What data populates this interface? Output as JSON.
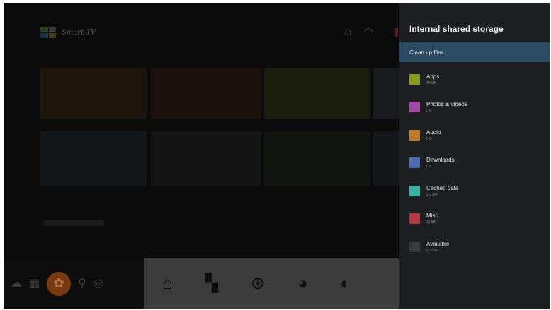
{
  "launcher": {
    "logo_text": "Smart TV"
  },
  "panel": {
    "title": "Internal shared storage",
    "clean_up_label": "Clean up files",
    "items": [
      {
        "label": "Apps",
        "value": "13 MB",
        "color": "#8a9a1c"
      },
      {
        "label": "Photos & videos",
        "value": "0 B",
        "color": "#a24aa8"
      },
      {
        "label": "Audio",
        "value": "0 B",
        "color": "#c07a2c"
      },
      {
        "label": "Downloads",
        "value": "0 B",
        "color": "#4a6cb4"
      },
      {
        "label": "Cached data",
        "value": "2.3 MB",
        "color": "#3ab2a8"
      },
      {
        "label": "Misc.",
        "value": "33 kB",
        "color": "#b23a3e"
      },
      {
        "label": "Available",
        "value": "6.0 GB",
        "color": "#3a3b3e"
      }
    ]
  },
  "colors": {
    "panel_bg": "#1e1f22",
    "highlight": "#2c4a62",
    "settings_accent": "#7a3a10"
  },
  "icons": {
    "top": [
      "account-icon",
      "wifi-icon"
    ],
    "bottom_left": [
      "cloud-icon",
      "input-icon",
      "settings-icon",
      "search-icon",
      "cast-icon"
    ],
    "bottom_right": [
      "home-icon",
      "apps-icon",
      "movies-icon",
      "music-icon",
      "sports-icon"
    ]
  }
}
